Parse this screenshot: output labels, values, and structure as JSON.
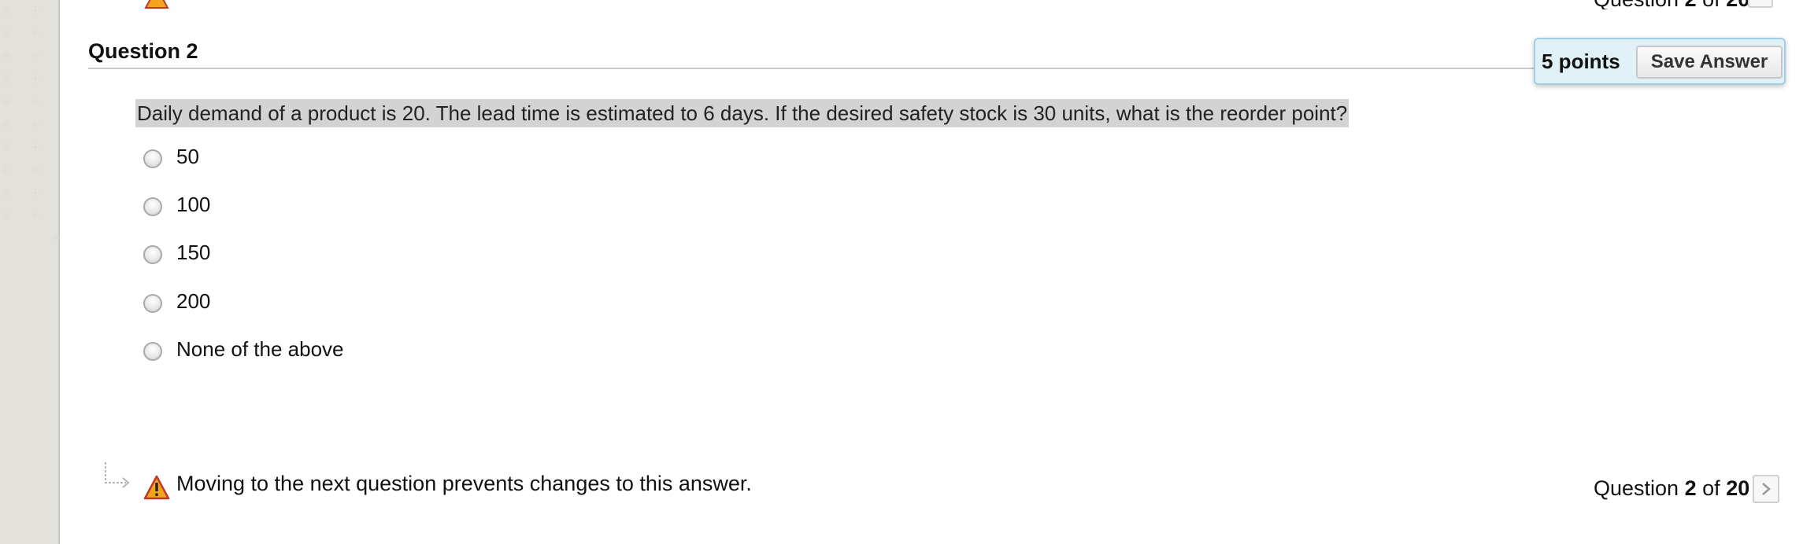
{
  "question": {
    "title": "Question 2",
    "points": "5 points",
    "save_label": "Save Answer",
    "text": "Daily demand of a product is 20. The lead time is estimated to 6 days. If the desired safety stock is 30 units, what is the reorder point?",
    "options": [
      "50",
      "100",
      "150",
      "200",
      "None of the above"
    ]
  },
  "footer": {
    "warning": "Moving to the next question prevents changes to this answer.",
    "counter_prefix": "Question",
    "current": "2",
    "of": "of",
    "total": "20"
  },
  "colors": {
    "points_box_bg": "#dff0f6",
    "question_highlight": "#d3d3d3",
    "warning_icon": "#f2a51b"
  },
  "icons": [
    "warning-icon",
    "chevron-right-icon",
    "indent-arrow-icon",
    "radio-button"
  ]
}
